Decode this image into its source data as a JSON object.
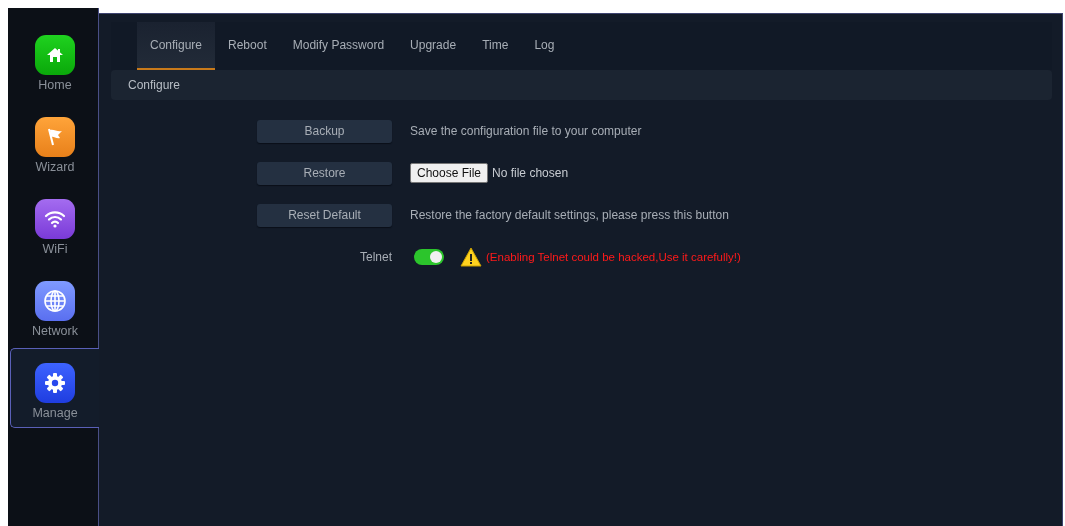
{
  "sidebar": {
    "items": [
      {
        "label": "Home",
        "kind": "home",
        "selected": false
      },
      {
        "label": "Wizard",
        "kind": "wizard",
        "selected": false
      },
      {
        "label": "WiFi",
        "kind": "wifi",
        "selected": false
      },
      {
        "label": "Network",
        "kind": "network",
        "selected": false
      },
      {
        "label": "Manage",
        "kind": "manage",
        "selected": true
      }
    ]
  },
  "tabs": [
    {
      "label": "Configure",
      "selected": true
    },
    {
      "label": "Reboot",
      "selected": false
    },
    {
      "label": "Modify Password",
      "selected": false
    },
    {
      "label": "Upgrade",
      "selected": false
    },
    {
      "label": "Time",
      "selected": false
    },
    {
      "label": "Log",
      "selected": false
    }
  ],
  "section_title": "Configure",
  "rows": [
    {
      "kind": "button",
      "button": "Backup",
      "description": "Save the configuration file to your computer"
    },
    {
      "kind": "file",
      "button": "Restore",
      "file_button": "Choose File",
      "file_status": "No file chosen"
    },
    {
      "kind": "button",
      "button": "Reset Default",
      "description": "Restore the factory default settings, please press this button"
    },
    {
      "kind": "toggle",
      "label": "Telnet",
      "on": true,
      "warning": "(Enabling Telnet could be hacked,Use it carefully!)"
    }
  ]
}
